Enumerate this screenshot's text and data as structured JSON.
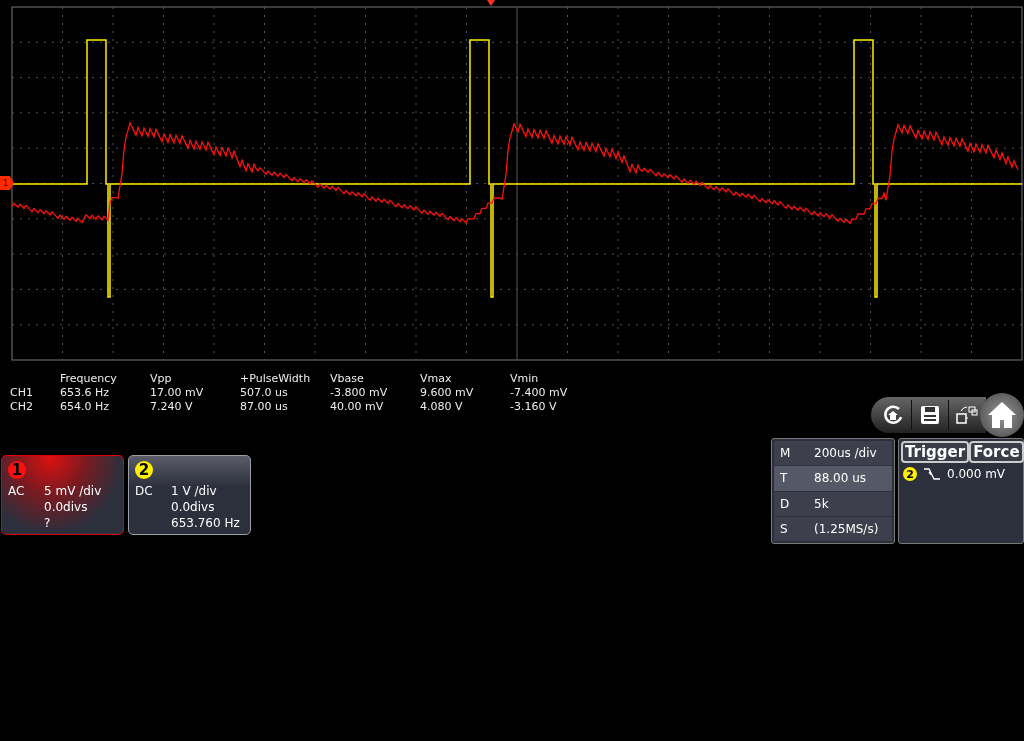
{
  "scope": {
    "channel_marker": "1"
  },
  "measurements": {
    "columns": [
      "Frequency",
      "Vpp",
      "+PulseWidth",
      "Vbase",
      "Vmax",
      "Vmin"
    ],
    "rows": [
      {
        "label": "CH1",
        "values": [
          "653.6 Hz",
          "17.00 mV",
          "507.0 us",
          "-3.800 mV",
          "9.600 mV",
          "-7.400 mV"
        ]
      },
      {
        "label": "CH2",
        "values": [
          "654.0 Hz",
          "7.240 V",
          "87.00 us",
          "40.00 mV",
          "4.080 V",
          "-3.160 V"
        ]
      }
    ]
  },
  "channels": [
    {
      "number": "1",
      "coupling": "AC",
      "scale": "5 mV /div",
      "offset": "0.0divs",
      "reading": "?",
      "selected": true,
      "color": "#ff1010"
    },
    {
      "number": "2",
      "coupling": "DC",
      "scale": "1 V /div",
      "offset": "0.0divs",
      "reading": "653.760 Hz",
      "selected": false,
      "color": "#ffee00"
    }
  ],
  "timebase": [
    {
      "key": "M",
      "value": "200us /div",
      "selected": false
    },
    {
      "key": "T",
      "value": "88.00 us",
      "selected": true
    },
    {
      "key": "D",
      "value": "5k",
      "selected": false
    },
    {
      "key": "S",
      "value": "(1.25MS/s)",
      "selected": false
    }
  ],
  "trigger": {
    "title": "Trigger",
    "force": "Force",
    "source": "2",
    "level": "0.000 mV"
  }
}
